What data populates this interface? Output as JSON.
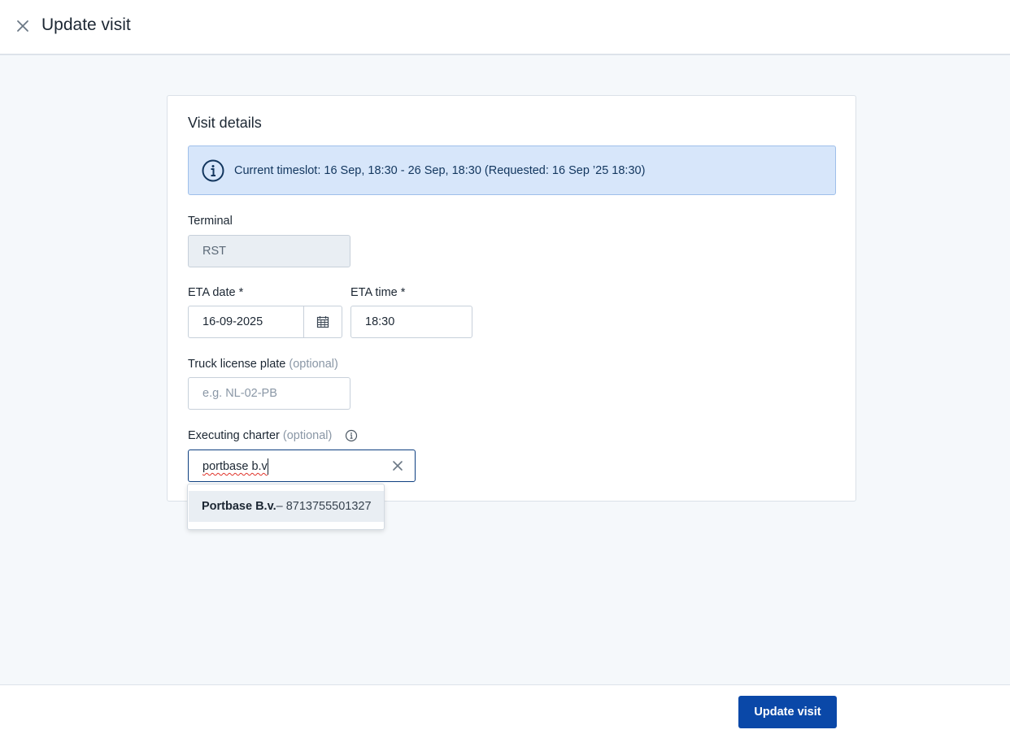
{
  "header": {
    "title": "Update visit",
    "close_icon": "close-icon"
  },
  "card": {
    "title": "Visit details",
    "banner_text": "Current timeslot: 16 Sep, 18:30 - 26 Sep, 18:30 (Requested: 16 Sep ’25 18:30)",
    "terminal": {
      "label": "Terminal",
      "value": "RST"
    },
    "eta_date": {
      "label": "ETA date *",
      "value": "16-09-2025"
    },
    "eta_time": {
      "label": "ETA time *",
      "value": "18:30"
    },
    "license_plate": {
      "label": "Truck license plate",
      "optional": "(optional)",
      "placeholder": "e.g. NL-02-PB"
    },
    "charter": {
      "label": "Executing charter",
      "optional": "(optional)",
      "value": "portbase b.v"
    }
  },
  "dropdown": {
    "options": [
      {
        "name": "Portbase B.v.",
        "suffix": " – 8713755501327"
      }
    ]
  },
  "footer": {
    "submit_label": "Update visit"
  },
  "colors": {
    "primary": "#0a48a8",
    "banner_bg": "#d7e6fa",
    "banner_border": "#9fbfea",
    "focus_border": "#0d3f80"
  }
}
